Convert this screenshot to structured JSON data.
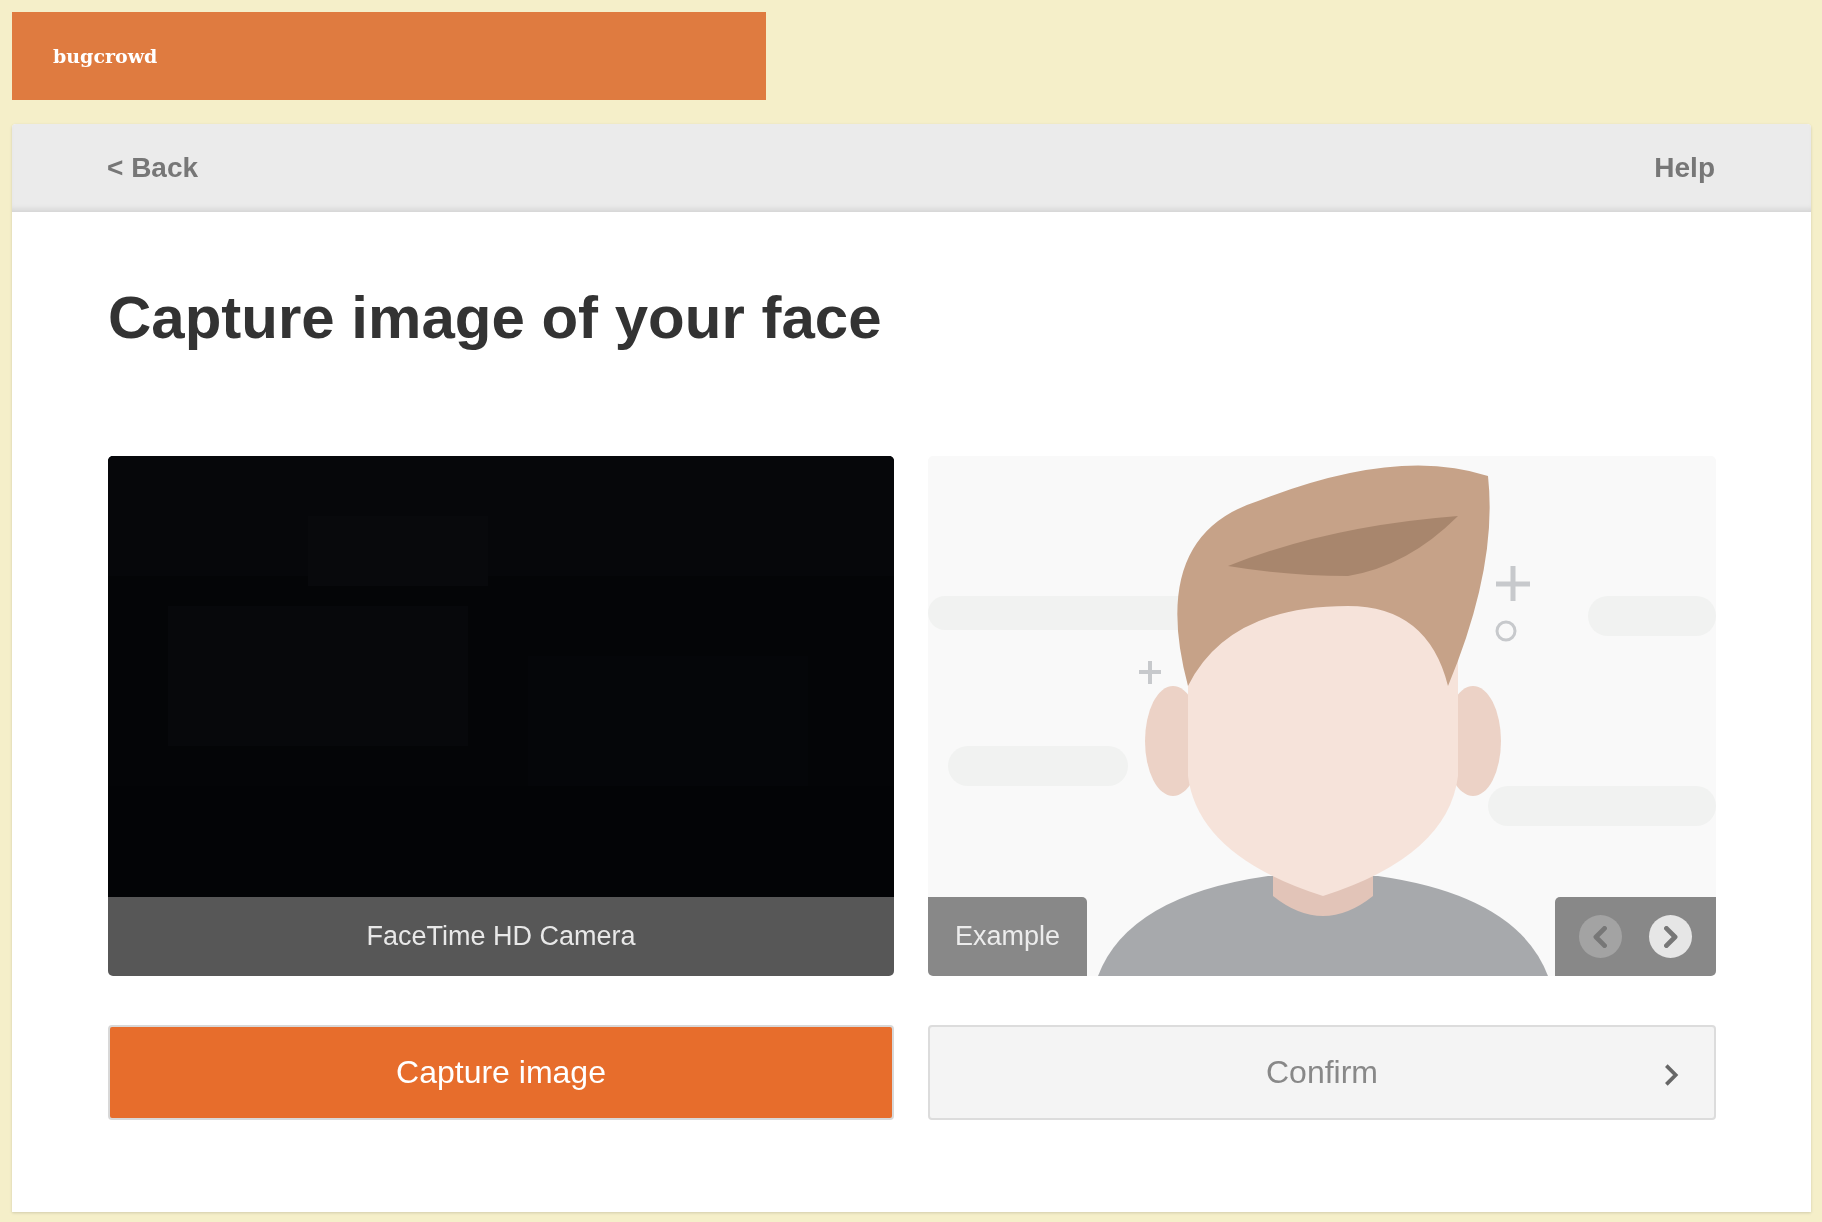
{
  "logo": "bugcrowd",
  "nav": {
    "back": "< Back",
    "help": "Help"
  },
  "title": "Capture image of your face",
  "camera": {
    "kind": "picture",
    "caption": "FaceTime HD Camera"
  },
  "example": {
    "label": "Example",
    "arrows": [
      {
        "kind": "prev",
        "disabled": true
      },
      {
        "kind": "next",
        "disabled": false
      }
    ]
  },
  "buttons": [
    {
      "label": "Capture image",
      "kind": "primary",
      "disabled": false
    },
    {
      "label": "Confirm",
      "kind": "secondary",
      "disabled": true
    }
  ]
}
